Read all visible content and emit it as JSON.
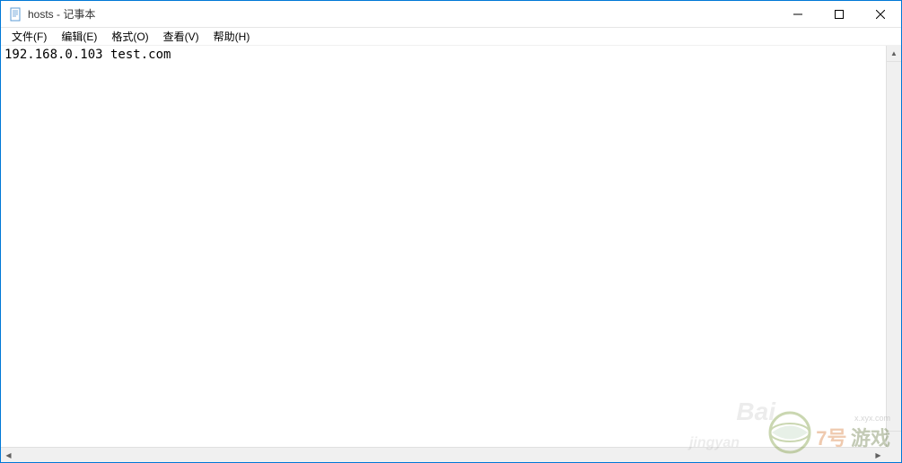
{
  "window": {
    "title": "hosts - 记事本"
  },
  "menu": {
    "file": "文件(F)",
    "edit": "编辑(E)",
    "format": "格式(O)",
    "view": "查看(V)",
    "help": "帮助(H)"
  },
  "editor": {
    "content": "192.168.0.103 test.com"
  },
  "watermarks": {
    "baidu": "Bai",
    "jingyan": "jingyan",
    "logo_num": "7号",
    "logo_text": "游戏",
    "logo_url": "x.xyx.com"
  }
}
